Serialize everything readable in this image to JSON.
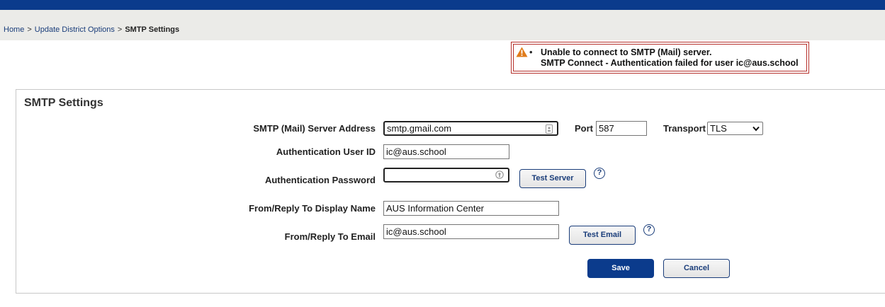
{
  "breadcrumb": {
    "home": "Home",
    "sep1": ">",
    "parent": "Update District Options",
    "sep2": ">",
    "current": "SMTP Settings"
  },
  "alert": {
    "bullet": "•",
    "line1": "Unable to connect to SMTP (Mail) server.",
    "line2": "SMTP Connect - Authentication failed for user ic@aus.school"
  },
  "panel": {
    "title": "SMTP Settings"
  },
  "form": {
    "server_label": "SMTP (Mail) Server Address",
    "server_value": "smtp.gmail.com",
    "port_label": "Port",
    "port_value": "587",
    "transport_label": "Transport",
    "transport_value": "TLS",
    "userid_label": "Authentication User ID",
    "userid_value": "ic@aus.school",
    "password_label": "Authentication Password",
    "password_value": "",
    "display_name_label": "From/Reply To Display Name",
    "display_name_value": "AUS Information Center",
    "email_label": "From/Reply To Email",
    "email_value": "ic@aus.school"
  },
  "buttons": {
    "test_server": "Test Server",
    "test_email": "Test Email",
    "save": "Save",
    "cancel": "Cancel",
    "help": "?"
  },
  "colors": {
    "brand": "#0b3b8c",
    "alert_border": "#b5302b",
    "warning": "#e07b1a"
  }
}
